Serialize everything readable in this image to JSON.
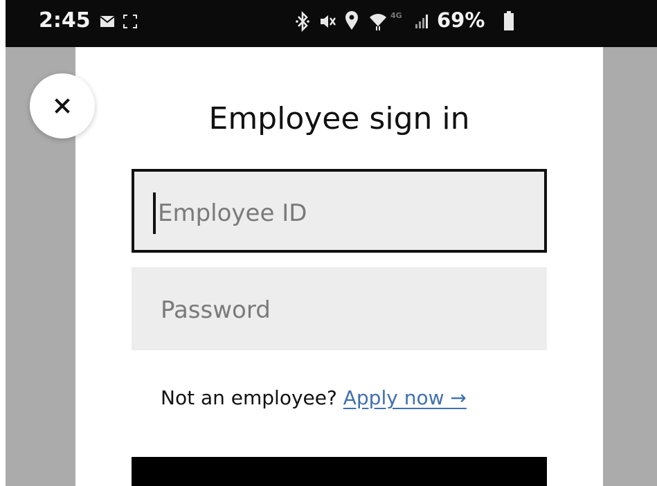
{
  "status_bar": {
    "time": "2:45",
    "lte_label": "4G",
    "battery": "69%",
    "icons": [
      "mail-icon",
      "screenshot-icon",
      "bluetooth-icon",
      "mute-icon",
      "location-icon",
      "wifi-icon",
      "signal-icon",
      "battery-icon"
    ]
  },
  "dialog": {
    "title": "Employee sign in",
    "close_icon": "close-icon",
    "employee_id_placeholder": "Employee ID",
    "password_placeholder": "Password",
    "apply_prompt": "Not an employee?",
    "apply_link": "Apply now →"
  },
  "colors": {
    "backdrop": "#ababab",
    "field_background": "#ededed",
    "link": "#3f6fb0",
    "button": "#000000"
  }
}
